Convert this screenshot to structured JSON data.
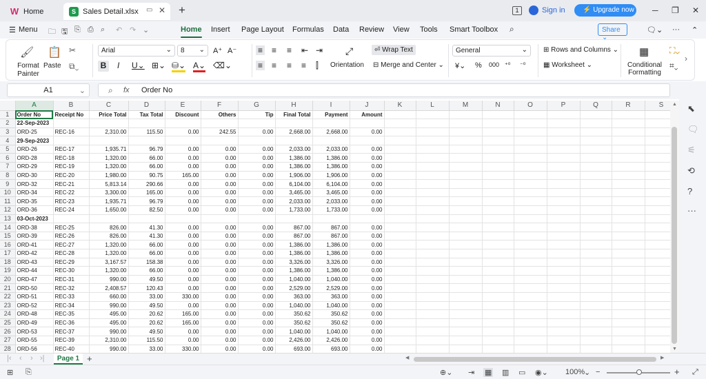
{
  "tabs": {
    "home_label": "Home",
    "file_label": "Sales Detail.xlsx"
  },
  "account": {
    "sign_in": "Sign in",
    "upgrade": "Upgrade now",
    "badge": "1"
  },
  "menu": {
    "menu_label": "Menu",
    "tabs": [
      "Home",
      "Insert",
      "Page Layout",
      "Formulas",
      "Data",
      "Review",
      "View",
      "Tools",
      "Smart Toolbox"
    ],
    "share_label": "Share"
  },
  "ribbon": {
    "format_painter": "Format Painter",
    "paste": "Paste",
    "font_name": "Arial",
    "font_size": "8",
    "wrap_text": "Wrap Text",
    "orientation": "Orientation",
    "merge_center": "Merge and Center",
    "number_format": "General",
    "rows_columns": "Rows and Columns",
    "worksheet": "Worksheet",
    "conditional_formatting": "Conditional Formatting"
  },
  "formula_bar": {
    "name_box": "A1",
    "fx": "fx",
    "content": "Order No"
  },
  "columns": [
    "A",
    "B",
    "C",
    "D",
    "E",
    "F",
    "G",
    "H",
    "I",
    "J",
    "K",
    "L",
    "M",
    "N",
    "O",
    "P",
    "Q",
    "R",
    "S"
  ],
  "rows": [
    {
      "n": "1",
      "c": [
        "Order No",
        "Receipt No",
        "Price Total",
        "Tax Total",
        "Discount",
        "Others",
        "Tip",
        "Final Total",
        "Payment",
        "Amount"
      ],
      "hdr": true
    },
    {
      "n": "2",
      "c": [
        "22-Sep-2023"
      ],
      "group": true
    },
    {
      "n": "3",
      "c": [
        "ORD-25",
        "REC-16",
        "2,310.00",
        "115.50",
        "0.00",
        "242.55",
        "0.00",
        "2,668.00",
        "2,668.00",
        "0.00"
      ]
    },
    {
      "n": "4",
      "c": [
        "29-Sep-2023"
      ],
      "group": true
    },
    {
      "n": "5",
      "c": [
        "ORD-26",
        "REC-17",
        "1,935.71",
        "96.79",
        "0.00",
        "0.00",
        "0.00",
        "2,033.00",
        "2,033.00",
        "0.00"
      ]
    },
    {
      "n": "6",
      "c": [
        "ORD-28",
        "REC-18",
        "1,320.00",
        "66.00",
        "0.00",
        "0.00",
        "0.00",
        "1,386.00",
        "1,386.00",
        "0.00"
      ]
    },
    {
      "n": "7",
      "c": [
        "ORD-29",
        "REC-19",
        "1,320.00",
        "66.00",
        "0.00",
        "0.00",
        "0.00",
        "1,386.00",
        "1,386.00",
        "0.00"
      ]
    },
    {
      "n": "8",
      "c": [
        "ORD-30",
        "REC-20",
        "1,980.00",
        "90.75",
        "165.00",
        "0.00",
        "0.00",
        "1,906.00",
        "1,906.00",
        "0.00"
      ]
    },
    {
      "n": "9",
      "c": [
        "ORD-32",
        "REC-21",
        "5,813.14",
        "290.66",
        "0.00",
        "0.00",
        "0.00",
        "6,104.00",
        "6,104.00",
        "0.00"
      ]
    },
    {
      "n": "10",
      "c": [
        "ORD-34",
        "REC-22",
        "3,300.00",
        "165.00",
        "0.00",
        "0.00",
        "0.00",
        "3,465.00",
        "3,465.00",
        "0.00"
      ]
    },
    {
      "n": "11",
      "c": [
        "ORD-35",
        "REC-23",
        "1,935.71",
        "96.79",
        "0.00",
        "0.00",
        "0.00",
        "2,033.00",
        "2,033.00",
        "0.00"
      ]
    },
    {
      "n": "12",
      "c": [
        "ORD-36",
        "REC-24",
        "1,650.00",
        "82.50",
        "0.00",
        "0.00",
        "0.00",
        "1,733.00",
        "1,733.00",
        "0.00"
      ]
    },
    {
      "n": "13",
      "c": [
        "03-Oct-2023"
      ],
      "group": true
    },
    {
      "n": "14",
      "c": [
        "ORD-38",
        "REC-25",
        "826.00",
        "41.30",
        "0.00",
        "0.00",
        "0.00",
        "867.00",
        "867.00",
        "0.00"
      ]
    },
    {
      "n": "15",
      "c": [
        "ORD-39",
        "REC-26",
        "826.00",
        "41.30",
        "0.00",
        "0.00",
        "0.00",
        "867.00",
        "867.00",
        "0.00"
      ]
    },
    {
      "n": "16",
      "c": [
        "ORD-41",
        "REC-27",
        "1,320.00",
        "66.00",
        "0.00",
        "0.00",
        "0.00",
        "1,386.00",
        "1,386.00",
        "0.00"
      ]
    },
    {
      "n": "17",
      "c": [
        "ORD-42",
        "REC-28",
        "1,320.00",
        "66.00",
        "0.00",
        "0.00",
        "0.00",
        "1,386.00",
        "1,386.00",
        "0.00"
      ]
    },
    {
      "n": "18",
      "c": [
        "ORD-43",
        "REC-29",
        "3,167.57",
        "158.38",
        "0.00",
        "0.00",
        "0.00",
        "3,326.00",
        "3,326.00",
        "0.00"
      ]
    },
    {
      "n": "19",
      "c": [
        "ORD-44",
        "REC-30",
        "1,320.00",
        "66.00",
        "0.00",
        "0.00",
        "0.00",
        "1,386.00",
        "1,386.00",
        "0.00"
      ]
    },
    {
      "n": "20",
      "c": [
        "ORD-47",
        "REC-31",
        "990.00",
        "49.50",
        "0.00",
        "0.00",
        "0.00",
        "1,040.00",
        "1,040.00",
        "0.00"
      ]
    },
    {
      "n": "21",
      "c": [
        "ORD-50",
        "REC-32",
        "2,408.57",
        "120.43",
        "0.00",
        "0.00",
        "0.00",
        "2,529.00",
        "2,529.00",
        "0.00"
      ]
    },
    {
      "n": "22",
      "c": [
        "ORD-51",
        "REC-33",
        "660.00",
        "33.00",
        "330.00",
        "0.00",
        "0.00",
        "363.00",
        "363.00",
        "0.00"
      ]
    },
    {
      "n": "23",
      "c": [
        "ORD-52",
        "REC-34",
        "990.00",
        "49.50",
        "0.00",
        "0.00",
        "0.00",
        "1,040.00",
        "1,040.00",
        "0.00"
      ]
    },
    {
      "n": "24",
      "c": [
        "ORD-48",
        "REC-35",
        "495.00",
        "20.62",
        "165.00",
        "0.00",
        "0.00",
        "350.62",
        "350.62",
        "0.00"
      ]
    },
    {
      "n": "25",
      "c": [
        "ORD-49",
        "REC-36",
        "495.00",
        "20.62",
        "165.00",
        "0.00",
        "0.00",
        "350.62",
        "350.62",
        "0.00"
      ]
    },
    {
      "n": "26",
      "c": [
        "ORD-53",
        "REC-37",
        "990.00",
        "49.50",
        "0.00",
        "0.00",
        "0.00",
        "1,040.00",
        "1,040.00",
        "0.00"
      ]
    },
    {
      "n": "27",
      "c": [
        "ORD-55",
        "REC-39",
        "2,310.00",
        "115.50",
        "0.00",
        "0.00",
        "0.00",
        "2,426.00",
        "2,426.00",
        "0.00"
      ]
    },
    {
      "n": "28",
      "c": [
        "ORD-56",
        "REC-40",
        "990.00",
        "33.00",
        "330.00",
        "0.00",
        "0.00",
        "693.00",
        "693.00",
        "0.00"
      ]
    }
  ],
  "sheet": {
    "active": "Page 1",
    "zoom": "100%"
  },
  "colors": {
    "accent": "#1d7a45",
    "brand_blue": "#2f8df5",
    "upgrade": "#2f8df5"
  }
}
